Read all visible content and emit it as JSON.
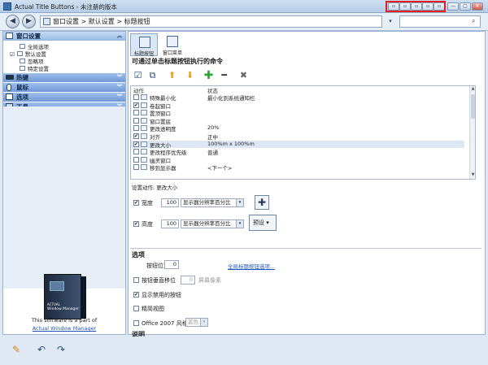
{
  "window": {
    "title": "Actual Title Buttons - 未注册的版本",
    "controls": [
      "▫",
      "▫",
      "▫",
      "▫",
      "▫",
      "—",
      "▢",
      "✕"
    ]
  },
  "nav": {
    "back": "◀",
    "forward": "▶",
    "breadcrumb": "窗口设置 > 默认设置 > 标题按钮",
    "search_placeholder": ""
  },
  "sidebar": {
    "panels": [
      {
        "label": "窗口设置",
        "chevron": "︽"
      },
      {
        "label": "热键",
        "chevron": "︾"
      },
      {
        "label": "鼠标",
        "chevron": "︾"
      },
      {
        "label": "选项",
        "chevron": "︾"
      },
      {
        "label": "工具",
        "chevron": "︾"
      }
    ],
    "tree_items": [
      "全局选项",
      "默认设置",
      "忽略项",
      "特定设置"
    ],
    "tree_checked": "☑",
    "promo_text": "This software is a part of",
    "promo_link": "Actual Window Manager",
    "box_brand_top": "ACTUAL",
    "box_brand": "Window Manager"
  },
  "tabs": [
    {
      "label": "标题按钮",
      "active": true
    },
    {
      "label": "窗口菜单",
      "active": false
    }
  ],
  "commands": {
    "title": "可通过单击标题按钮执行的命令",
    "toolbar": [
      "☑",
      "⧉",
      "⬆",
      "⬇",
      "✚",
      "━",
      "✖"
    ],
    "col_action": "动作",
    "col_state": "状态",
    "rows": [
      {
        "name": "特殊最小化",
        "state": "最小化到系统通知栏",
        "checked": false
      },
      {
        "name": "卷起窗口",
        "state": "",
        "checked": true
      },
      {
        "name": "置顶窗口",
        "state": "",
        "checked": false
      },
      {
        "name": "窗口置底",
        "state": "",
        "checked": false
      },
      {
        "name": "更改透明度",
        "state": "20%",
        "checked": false
      },
      {
        "name": "对齐",
        "state": "正中",
        "checked": true
      },
      {
        "name": "更改大小",
        "state": "100%m x 100%m",
        "checked": true,
        "selected": true
      },
      {
        "name": "更改程序优先级",
        "state": "普通",
        "checked": false
      },
      {
        "name": "幽灵窗口",
        "state": "",
        "checked": false
      },
      {
        "name": "移到显示器",
        "state": "<下一个>",
        "checked": false
      }
    ]
  },
  "action_settings": {
    "label": "设置动作: 更改大小",
    "width_label": "宽度",
    "width_value": "100",
    "width_unit": "显示器分辨率百分比",
    "height_label": "高度",
    "height_value": "100",
    "height_unit": "显示器分辨率百分比",
    "preset_label": "预设",
    "check": "✔",
    "dropdown": "▾"
  },
  "options": {
    "title": "选项",
    "button_pos_label": "按钮位置",
    "button_pos_value": "0",
    "global_link": "全局标题按钮选项...",
    "vertical_shift_label": "按钮垂直移位",
    "vertical_shift_value": "0",
    "vertical_shift_unit": "屏幕像素",
    "show_disabled_label": "显示禁用的按钮",
    "compact_label": "精简视图",
    "office_style_label": "Office 2007 风格",
    "office_style_value": "蓝色",
    "desc_title": "说明",
    "check": "✔"
  },
  "bottom_icons": [
    "✎",
    "↶",
    "↷"
  ]
}
